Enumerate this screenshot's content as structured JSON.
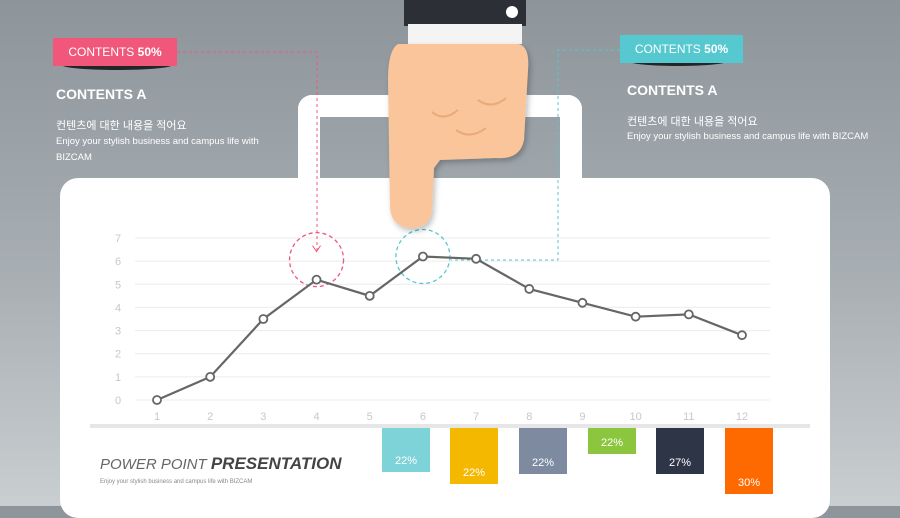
{
  "left_block": {
    "tag_prefix": "CONTENTS ",
    "tag_value": "50%",
    "tag_color": "#f0577a",
    "title": "CONTENTS A",
    "korean": "컨텐츠에 대한 내용을 적어요",
    "english_line1": "Enjoy your stylish business and campus life with",
    "english_line2": "BIZCAM"
  },
  "right_block": {
    "tag_prefix": "CONTENTS ",
    "tag_value": "50%",
    "tag_color": "#56c8cf",
    "title": "CONTENTS A",
    "korean": "컨텐츠에 대한 내용을 적어요",
    "english": "Enjoy your stylish business and campus life with  BIZCAM"
  },
  "footer": {
    "title_prefix": "POWER POINT ",
    "title_bold": "PRESENTATION",
    "subtitle": "Enjoy your stylish business and campus life with BIZCAM"
  },
  "chart_data": [
    {
      "type": "line",
      "x": [
        1,
        2,
        3,
        4,
        5,
        6,
        7,
        8,
        9,
        10,
        11,
        12
      ],
      "values": [
        0,
        1,
        3.5,
        5.2,
        4.5,
        6.2,
        6.1,
        4.8,
        4.2,
        3.6,
        3.7,
        2.8
      ],
      "ylim": [
        0,
        7
      ],
      "yticks": [
        0,
        1,
        2,
        3,
        4,
        5,
        6,
        7
      ],
      "grid": true,
      "highlighted_x": [
        4,
        6
      ],
      "highlight_colors": [
        "#f0577a",
        "#56c8cf"
      ],
      "line_color": "#666666"
    },
    {
      "type": "bar",
      "labels": [
        "22%",
        "22%",
        "22%",
        "22%",
        "27%",
        "30%"
      ],
      "values": [
        22,
        22,
        22,
        22,
        27,
        30
      ],
      "colors": [
        "#7dd3d8",
        "#f5b800",
        "#7d8aa0",
        "#8cc63f",
        "#2e3546",
        "#ff6a00"
      ]
    }
  ],
  "icons": {
    "hand": "pointing-hand-icon"
  }
}
